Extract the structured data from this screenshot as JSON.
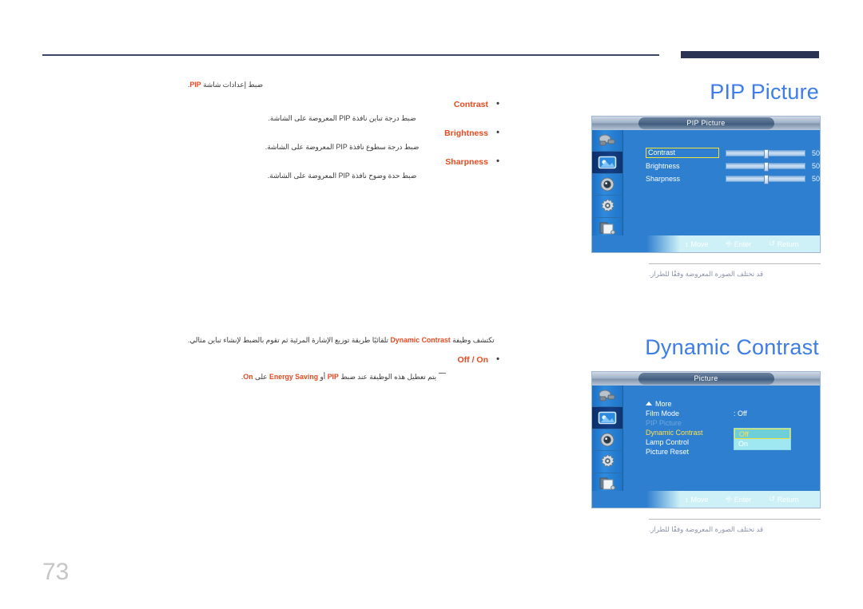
{
  "page": {
    "number": "73"
  },
  "header": {
    "rule": "divider",
    "tab": "section-tab"
  },
  "sections": [
    {
      "id": "pip_picture",
      "title": "PIP Picture",
      "intro": "ضبط إعدادات شاشة PIP.",
      "intro_keyword": "PIP",
      "bullets": [
        {
          "label": "Contrast",
          "desc": "ضبط درجة تباين نافذة PIP المعروضة على الشاشة."
        },
        {
          "label": "Brightness",
          "desc": "ضبط درجة سطوع نافذة PIP المعروضة على الشاشة."
        },
        {
          "label": "Sharpness",
          "desc": "ضبط حدة وضوح نافذة PIP المعروضة على الشاشة."
        }
      ],
      "osd": {
        "title": "PIP Picture",
        "rows": [
          {
            "label": "Contrast",
            "value": "50",
            "percent": 50,
            "selected": true
          },
          {
            "label": "Brightness",
            "value": "50",
            "percent": 50,
            "selected": false
          },
          {
            "label": "Sharpness",
            "value": "50",
            "percent": 50,
            "selected": false
          }
        ],
        "hints": {
          "move": "Move",
          "enter": "Enter",
          "return": "Return"
        }
      },
      "caption": "قد تختلف الصورة المعروضة وفقًا للطراز."
    },
    {
      "id": "dynamic_contrast",
      "title": "Dynamic Contrast",
      "intro": "تكتشف وظيفة Dynamic Contrast تلقائيًا طريقة توزيع الإشارة المرئية ثم تقوم بالضبط لإنشاء تباين مثالي.",
      "intro_keyword": "Dynamic Contrast",
      "bullets": [
        {
          "label": "Off / On",
          "desc": ""
        }
      ],
      "note": {
        "text_a": "يتم تعطيل هذه الوظيفة عند ضبط ",
        "kw_1": "PIP",
        "text_b": " أو ",
        "kw_2": "Energy Saving",
        "text_c": " على ",
        "kw_3": "On",
        "text_d": "."
      },
      "osd": {
        "title": "Picture",
        "items": [
          {
            "label": "More",
            "value": "",
            "state": "normal",
            "icon": "caret-up"
          },
          {
            "label": "Film Mode",
            "value": ": Off",
            "state": "normal"
          },
          {
            "label": "PIP Picture",
            "value": "",
            "state": "disabled"
          },
          {
            "label": "Dynamic Contrast",
            "value": ":",
            "state": "selected"
          },
          {
            "label": "Lamp Control",
            "value": ":",
            "state": "normal"
          },
          {
            "label": "Picture Reset",
            "value": "",
            "state": "normal"
          }
        ],
        "dropdown": {
          "options": [
            "Off",
            "On"
          ],
          "selected": "Off"
        },
        "hints": {
          "move": "Move",
          "enter": "Enter",
          "return": "Return"
        }
      },
      "caption": "قد تختلف الصورة المعروضة وفقًا للطراز."
    }
  ],
  "osd_sidebar_icons": [
    "input-source-icon",
    "picture-icon",
    "sound-icon",
    "setup-gear-icon",
    "multi-control-icon"
  ],
  "colors": {
    "title_blue": "#3d7de8",
    "keyword_red": "#e8491f",
    "osd_blue": "#2f7fd0",
    "highlight_yellow": "#ffe14d",
    "header_navy": "#2b3354"
  }
}
